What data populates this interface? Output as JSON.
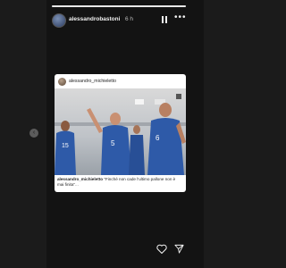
{
  "story": {
    "username": "alessandrobastoni",
    "time": "6 h",
    "progress": 1.0
  },
  "post": {
    "username": "alessandro_michieletto",
    "caption_user": "alessandro_michieletto",
    "caption_text": "\"Finché non cade l'ultimo pallone non è mai finita\"",
    "caption_more": "..."
  },
  "photo": {
    "jersey_numbers": [
      "5",
      "15",
      "6"
    ],
    "jersey_color": "#2e5aa8"
  },
  "icons": [
    "heart-icon",
    "send-icon",
    "pause-icon",
    "more-icon",
    "chevron-left-icon"
  ]
}
